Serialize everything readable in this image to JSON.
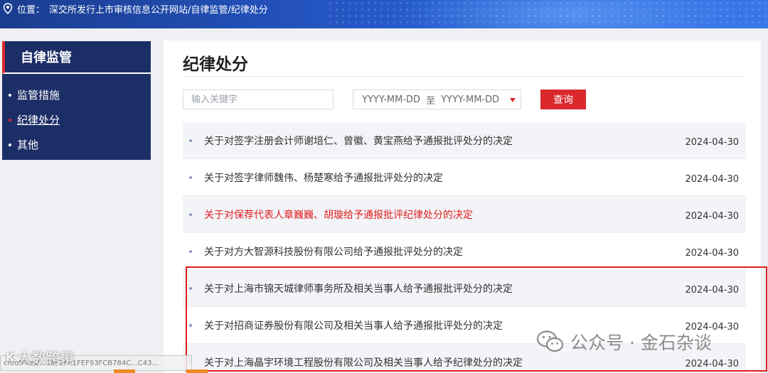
{
  "breadcrumb": {
    "label": "位置：",
    "path": "深交所发行上市审核信息公开网站/自律监管/纪律处分"
  },
  "sidebar": {
    "title": "自律监管",
    "items": [
      {
        "label": "监管措施",
        "active": false
      },
      {
        "label": "纪律处分",
        "active": true
      },
      {
        "label": "其他",
        "active": false
      }
    ]
  },
  "main": {
    "title": "纪律处分",
    "search": {
      "placeholder": "输入关键字",
      "value": ""
    },
    "date_range": {
      "start_placeholder": "YYYY-MM-DD",
      "separator": "至",
      "end_placeholder": "YYYY-MM-DD"
    },
    "query_label": "查询",
    "items": [
      {
        "title": "关于对签字注册会计师谢培仁、曾徽、黄宝燕给予通报批评处分的决定",
        "date": "2024-04-30",
        "highlight": false
      },
      {
        "title": "关于对签字律师魏伟、杨楚寒给予通报批评处分的决定",
        "date": "2024-04-30",
        "highlight": false
      },
      {
        "title": "关于对保荐代表人章巍巍、胡璇给予通报批评纪律处分的决定",
        "date": "2024-04-30",
        "highlight": true
      },
      {
        "title": "关于对方大智源科技股份有限公司给予通报批评处分的决定",
        "date": "2024-04-30",
        "highlight": false
      },
      {
        "title": "关于对上海市锦天城律师事务所及相关当事人给予通报批评处分的决定",
        "date": "2024-04-30",
        "highlight": false
      },
      {
        "title": "关于对招商证券股份有限公司及相关当事人给予通报批评处分的决定",
        "date": "2024-04-30",
        "highlight": false
      },
      {
        "title": "关于对上海晶宇环境工程股份有限公司及相关当事人给予纪律处分的决定",
        "date": "2024-04-30",
        "highlight": false
      }
    ]
  },
  "overlay": {
    "status_text": "cn/ofFiles/...18F2F41FEF93FCB784C...C43...",
    "watermark_left": "大数跨境",
    "watermark_left_mark": "K",
    "watermark_right": "公众号 · 金石杂谈"
  },
  "colors": {
    "accent": "#d9292d",
    "sidebar_bg": "#1c2e66",
    "alert_text": "#e02020"
  }
}
